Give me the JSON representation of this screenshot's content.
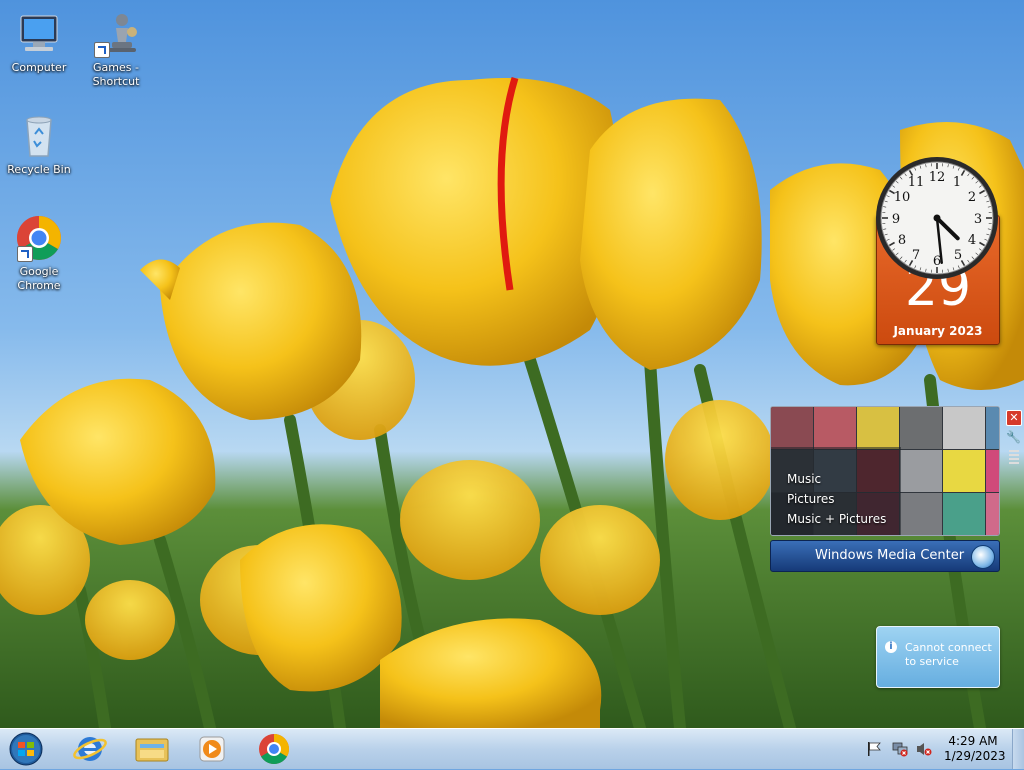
{
  "desktop": {
    "icons": [
      {
        "label": "Computer",
        "icon": "computer-icon"
      },
      {
        "label": "Games - Shortcut",
        "icon": "games-icon"
      },
      {
        "label": "Recycle Bin",
        "icon": "recycle-bin-icon"
      },
      {
        "label": "Google Chrome",
        "icon": "chrome-icon"
      }
    ]
  },
  "gadgets": {
    "calendar": {
      "day": "29",
      "month_year": "January 2023"
    },
    "clock": {
      "hour": 4,
      "minute": 29
    },
    "media_center": {
      "menu": [
        "Music",
        "Pictures",
        "Music + Pictures"
      ],
      "title_bold": "Windows",
      "title_rest": " Media Center"
    }
  },
  "notification": {
    "text": "Cannot connect to service",
    "icon": "info-icon"
  },
  "taskbar": {
    "pinned": [
      "start-orb-icon",
      "internet-explorer-icon",
      "file-explorer-icon",
      "media-player-icon",
      "chrome-icon"
    ],
    "tray": {
      "time": "4:29 AM",
      "date": "1/29/2023",
      "icons": [
        "action-center-flag-icon",
        "network-disconnected-icon",
        "volume-muted-icon"
      ]
    }
  },
  "colors": {
    "calendar_orange": "#e0611f",
    "taskbar": "#b9d1ea",
    "media_center_blue": "#1f4a8a"
  }
}
